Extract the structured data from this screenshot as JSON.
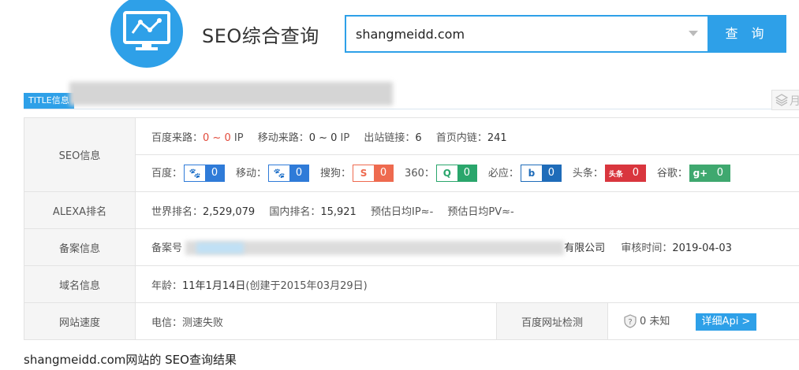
{
  "header": {
    "title": "SEO综合查询",
    "search_value": "shangmeidd.com",
    "search_button": "查 询"
  },
  "title_tag": "TITLE信息",
  "share_icon_text": "月",
  "rows": {
    "seo": {
      "label": "SEO信息",
      "line1": {
        "baidu_traffic_label": "百度来路：",
        "baidu_traffic_value": "0 ~ 0",
        "baidu_traffic_unit": "IP",
        "mobile_traffic_label": "移动来路：",
        "mobile_traffic_value": "0 ~ 0",
        "mobile_traffic_unit": "IP",
        "outlinks_label": "出站链接：",
        "outlinks_value": "6",
        "homepage_links_label": "首页内链：",
        "homepage_links_value": "241"
      },
      "engines": [
        {
          "label": "百度：",
          "icon": "baidu-paw-icon",
          "glyph": "🐾",
          "value": "0",
          "color": "#2f7bd8"
        },
        {
          "label": "移动：",
          "icon": "mobile-paw-icon",
          "glyph": "🐾",
          "value": "0",
          "color": "#2f7bd8"
        },
        {
          "label": "搜狗：",
          "icon": "sogou-icon",
          "glyph": "S",
          "value": "0",
          "color": "#ee6a4f"
        },
        {
          "label": "360：",
          "icon": "so360-icon",
          "glyph": "Q",
          "value": "0",
          "color": "#2aa66c"
        },
        {
          "label": "必应：",
          "icon": "bing-icon",
          "glyph": "b",
          "value": "0",
          "color": "#1f6cb9"
        },
        {
          "label": "头条：",
          "icon": "toutiao-icon",
          "glyph": "头条",
          "value": "0",
          "color": "#d9363e"
        },
        {
          "label": "谷歌：",
          "icon": "google-plus-icon",
          "glyph": "g+",
          "value": "0",
          "color": "#3fa86f"
        }
      ]
    },
    "alexa": {
      "label": "ALEXA排名",
      "world_label": "世界排名：",
      "world_value": "2,529,079",
      "domestic_label": "国内排名：",
      "domestic_value": "15,921",
      "ip_label": "预估日均IP≈",
      "ip_value": "-",
      "pv_label": "预估日均PV≈",
      "pv_value": "-"
    },
    "icp": {
      "label": "备案信息",
      "prefix": "备案号",
      "company_suffix": "有限公司",
      "audit_label": "审核时间：",
      "audit_value": "2019-04-03"
    },
    "domain": {
      "label": "域名信息",
      "age_label": "年龄：",
      "age_value": "11年1月14日",
      "created_note": "(创建于2015年03月29日)"
    },
    "speed": {
      "label": "网站速度",
      "telecom_label": "电信：",
      "telecom_value": "测速失败",
      "baidu_check_label": "百度网址检测",
      "baidu_check_value": "0 未知",
      "api_button": "详细Api >"
    }
  },
  "footer": "shangmeidd.com网站的 SEO查询结果"
}
